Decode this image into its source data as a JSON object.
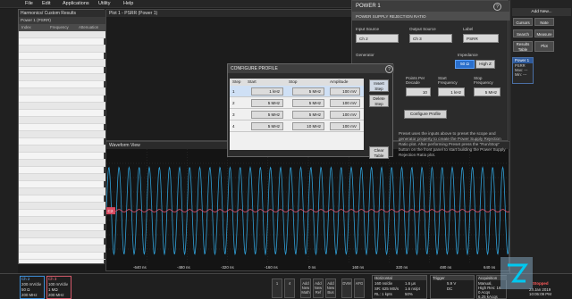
{
  "menu": [
    "File",
    "Edit",
    "Applications",
    "Utility",
    "Help"
  ],
  "harmonics": {
    "title": "Harmonics/ Custom Results",
    "tab": "Power 1 (PSRR)",
    "cols": [
      "Index",
      "Frequency",
      "Attenuation"
    ]
  },
  "plot": {
    "title": "Plot 1 - PSRR (Power 1)"
  },
  "wave": {
    "title": "Waveform View",
    "xticks": [
      "-640 ns",
      "-480 ns",
      "-320 ns",
      "-160 ns",
      "0 ns",
      "160 ns",
      "320 ns",
      "480 ns",
      "640 ns"
    ],
    "ch_marker": "C2",
    "cycles": 40
  },
  "power": {
    "title": "POWER 1",
    "subtitle": "POWER SUPPLY REJECTION RATIO",
    "input_label": "Input Source",
    "input_value": "Ch 2",
    "output_label": "Output Source",
    "output_value": "Ch 3",
    "label_label": "Label",
    "label_value": "PSRR",
    "generator_label": "Generator",
    "impedance_label": "Impedance",
    "imp_50": "50 Ω",
    "imp_high": "High Z",
    "ppd_label": "Points Per Decade",
    "ppd_value": "10",
    "start_label": "Start Frequency",
    "start_value": "1 kHz",
    "stop_label": "Stop Frequency",
    "stop_value": "5 MHz",
    "configure_btn": "Configure Profile",
    "desc": "Preset uses the inputs above to preset the scope and generator property to create the Power Supply Rejection Ratio plot. After performing Preset press the \"Run/Stop\" button on the front panel to start building the Power Supply Rejection Ratio plot."
  },
  "profile": {
    "title": "CONFIGURE PROFILE",
    "headers": [
      "Step",
      "Start",
      "Stop",
      "Amplitude"
    ],
    "rows": [
      {
        "step": "1",
        "start": "1 kHz",
        "stop": "5 MHz",
        "amp": "100 mV"
      },
      {
        "step": "2",
        "start": "5 MHz",
        "stop": "5 MHz",
        "amp": "100 mV"
      },
      {
        "step": "3",
        "start": "5 MHz",
        "stop": "5 MHz",
        "amp": "100 mV"
      },
      {
        "step": "4",
        "start": "5 MHz",
        "stop": "10 MHz",
        "amp": "100 mV"
      }
    ],
    "insert": "Insert Step",
    "delete": "Delete Step",
    "clear": "Clear Table"
  },
  "right": {
    "add_new": "Add New...",
    "buttons": [
      "Cursors",
      "Note",
      "Search",
      "Measure",
      "Results Table",
      "Plot"
    ],
    "badge": "Power 1",
    "badge_label": "PSRR",
    "badge_vals": [
      "Max: ---",
      "Min: ---"
    ]
  },
  "bottom": {
    "ch2": {
      "name": "Ch 2",
      "l1": "200 mV/div",
      "l2": "50 Ω",
      "l3": "200 MHz"
    },
    "ch3": {
      "name": "Ch 3",
      "l1": "100 mV/div",
      "l2": "1 MΩ",
      "l3": "200 MHz"
    },
    "tiles": [
      "1",
      "4",
      "Add New Math",
      "Add New Ref",
      "Add New Bus",
      "DVM",
      "AFG"
    ],
    "horizontal": {
      "title": "Horizontal",
      "l1": "160 ns/div",
      "l2": "SR: 625 MS/s",
      "l3": "RL: 1 kpts",
      "r1": "1.6 µs",
      "r2": "1.6 ns/pt",
      "r3": "50%"
    },
    "trigger": {
      "title": "Trigger",
      "l1": "5.9 V",
      "l2": "DC"
    },
    "acquisition": {
      "title": "Acquisition",
      "l1": "Manual,",
      "l2": "High Res: 16",
      "l3": "0 Acqs",
      "l4": "6.25 kAcqs"
    },
    "stopped": "Stopped",
    "time": "24 Jan 2019",
    "time2": "10:05:09 PM"
  }
}
